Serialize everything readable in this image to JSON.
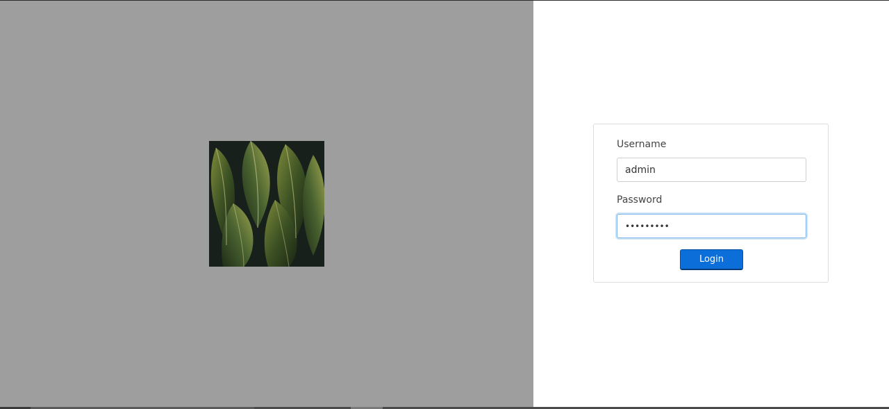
{
  "login": {
    "username_label": "Username",
    "username_value": "admin",
    "password_label": "Password",
    "password_value": "•••••••••",
    "login_button": "Login"
  },
  "colors": {
    "left_panel_bg": "#9e9e9e",
    "accent_button": "#0b6ed9",
    "focus_border": "#7eb4ea"
  },
  "image": {
    "subject": "dark green tropical leaves photo"
  }
}
